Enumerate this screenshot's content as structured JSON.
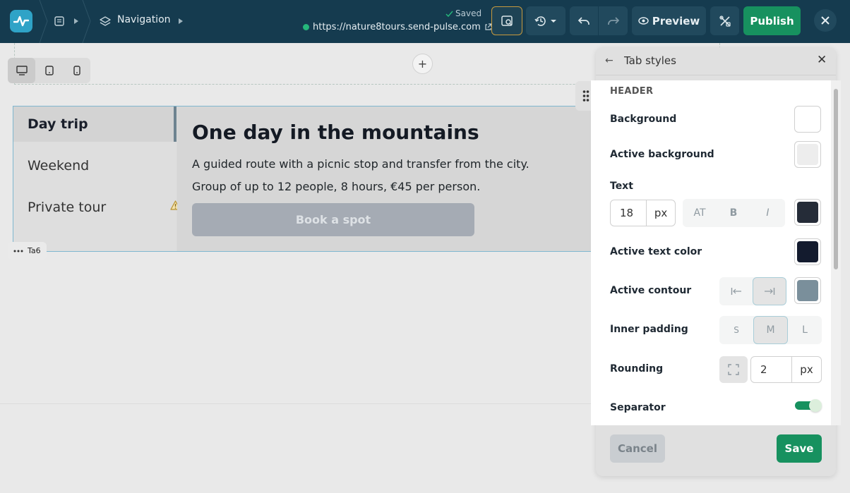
{
  "topbar": {
    "breadcrumb_label": "Navigation",
    "saved_label": "Saved",
    "url": "https://nature8tours.send-pulse.com",
    "preview_label": "Preview",
    "publish_label": "Publish"
  },
  "colors": {
    "topbar_bg": "#153b4f",
    "accent_green": "#17915f",
    "logo_bg": "#2fa3c7",
    "active_outline": "#c79a3e"
  },
  "canvas": {
    "tabs": [
      {
        "label": "Day trip",
        "active": true
      },
      {
        "label": "Weekend",
        "active": false
      },
      {
        "label": "Private tour",
        "active": false
      }
    ],
    "content_title": "One day in the mountains",
    "content_lines": [
      "A guided route with a picnic stop and transfer from the city.",
      "Group of up to 12 people, 8 hours, €45 per person."
    ],
    "book_button": "Book a spot",
    "element_tag": "Ta6"
  },
  "panel": {
    "title": "Tab styles",
    "section_header": "HEADER",
    "background_label": "Background",
    "background_color": "#ffffff",
    "active_background_label": "Active background",
    "active_background_color": "#ededed",
    "text_label": "Text",
    "text_size": "18",
    "text_unit": "px",
    "text_style_buttons": [
      "AT",
      "B",
      "I"
    ],
    "text_color": "#252c38",
    "active_text_color_label": "Active text color",
    "active_text_color": "#131b2e",
    "active_contour_label": "Active contour",
    "active_contour_color": "#7a8f9b",
    "inner_padding_label": "Inner padding",
    "inner_padding_options": [
      "S",
      "M",
      "L"
    ],
    "inner_padding_selected": "M",
    "rounding_label": "Rounding",
    "rounding_value": "2",
    "rounding_unit": "px",
    "separator_label": "Separator",
    "separator_on": true,
    "cancel_label": "Cancel",
    "save_label": "Save"
  }
}
